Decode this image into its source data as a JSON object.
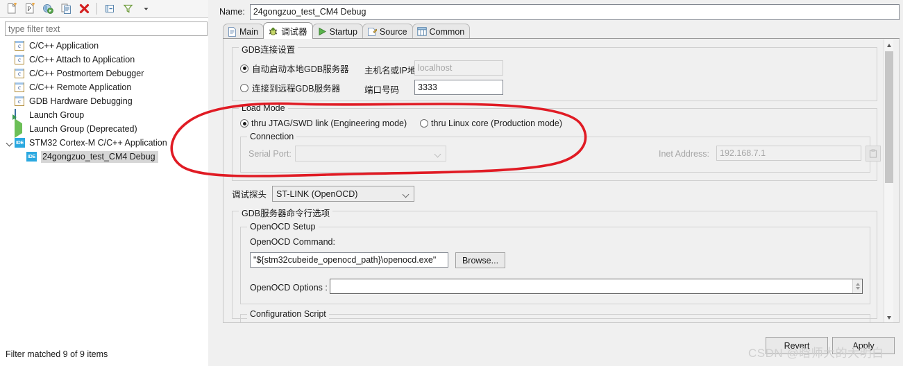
{
  "left_panel": {
    "toolbar": [
      {
        "name": "new-launch-configuration-icon",
        "title": "New launch configuration"
      },
      {
        "name": "new-prototype-icon",
        "title": "New prototype"
      },
      {
        "name": "new-launch-group-icon",
        "title": "New launch group"
      },
      {
        "name": "duplicate-icon",
        "title": "Duplicate"
      },
      {
        "name": "delete-icon",
        "title": "Delete"
      },
      {
        "name": "collapse-all-icon",
        "title": "Collapse All"
      },
      {
        "name": "filter-icon",
        "title": "Filter"
      },
      {
        "name": "view-menu-icon",
        "title": "View Menu"
      }
    ],
    "filter": {
      "value": "",
      "placeholder": "type filter text"
    },
    "tree": [
      {
        "label": "C/C++ Application",
        "icon": "c-file-icon",
        "indent": 1,
        "selected": false,
        "twisty": false
      },
      {
        "label": "C/C++ Attach to Application",
        "icon": "c-file-icon",
        "indent": 1,
        "selected": false,
        "twisty": false
      },
      {
        "label": "C/C++ Postmortem Debugger",
        "icon": "c-file-icon",
        "indent": 1,
        "selected": false,
        "twisty": false
      },
      {
        "label": "C/C++ Remote Application",
        "icon": "c-file-icon",
        "indent": 1,
        "selected": false,
        "twisty": false
      },
      {
        "label": "GDB Hardware Debugging",
        "icon": "c-file-icon",
        "indent": 1,
        "selected": false,
        "twisty": false
      },
      {
        "label": "Launch Group",
        "icon": "launch-group-icon",
        "indent": 1,
        "selected": false,
        "twisty": false
      },
      {
        "label": "Launch Group (Deprecated)",
        "icon": "play-icon",
        "indent": 1,
        "selected": false,
        "twisty": false
      },
      {
        "label": "STM32 Cortex-M C/C++ Application",
        "icon": "ide-icon",
        "indent": 0,
        "selected": false,
        "twisty": true
      },
      {
        "label": "24gongzuo_test_CM4 Debug",
        "icon": "ide-icon",
        "indent": 2,
        "selected": true,
        "twisty": false
      }
    ],
    "status": "Filter matched 9 of 9 items"
  },
  "right_panel": {
    "name_label": "Name:",
    "name_value": "24gongzuo_test_CM4 Debug",
    "tabs": [
      {
        "label": "Main",
        "icon": "document-icon",
        "active": false
      },
      {
        "label": "调试器",
        "icon": "bug-icon",
        "active": true
      },
      {
        "label": "Startup",
        "icon": "play-icon",
        "active": false
      },
      {
        "label": "Source",
        "icon": "source-icon",
        "active": false
      },
      {
        "label": "Common",
        "icon": "common-icon",
        "active": false
      }
    ],
    "gdb_connection": {
      "title": "GDB连接设置",
      "auto_start_label": "自动启动本地GDB服务器",
      "auto_start_selected": true,
      "remote_label": "连接到远程GDB服务器",
      "remote_selected": false,
      "host_label": "主机名或IP地址",
      "host_value": "localhost",
      "host_disabled": true,
      "port_label": "端口号码",
      "port_value": "3333"
    },
    "load_mode": {
      "title": "Load Mode",
      "jtag_label": "thru JTAG/SWD link (Engineering mode)",
      "jtag_selected": true,
      "linux_label": "thru Linux core (Production mode)",
      "linux_selected": false,
      "connection": {
        "title": "Connection",
        "serial_port_label": "Serial Port:",
        "serial_port_value": "",
        "serial_port_disabled": true,
        "inet_label": "Inet Address:",
        "inet_value": "192.168.7.1",
        "inet_disabled": true,
        "clipboard_icon": "clipboard-icon"
      }
    },
    "debug_probe": {
      "label": "调试探头",
      "value": "ST-LINK (OpenOCD)"
    },
    "gdb_server_options": {
      "title": "GDB服务器命令行选项",
      "openocd_setup": {
        "title": "OpenOCD Setup",
        "command_label": "OpenOCD Command:",
        "command_value": "\"${stm32cubeide_openocd_path}\\openocd.exe\"",
        "browse_label": "Browse...",
        "options_label": "OpenOCD Options :",
        "options_value": ""
      },
      "configuration_script": {
        "title": "Configuration Script"
      }
    },
    "buttons": {
      "revert": "Revert",
      "apply": "Apply"
    },
    "scrollbar": {
      "up_icon": "chevron-up-icon",
      "down_icon": "chevron-down-icon"
    }
  },
  "annotation": {
    "shape": "ellipse",
    "color": "#e01b24",
    "target": "Load Mode"
  },
  "watermark": "CSDN @晗师大的大明白",
  "colors": {
    "accent": "#2aa8e0",
    "annotation_red": "#e01b24",
    "panel_bg": "#f0f0f0",
    "selection": "#d6d6d6"
  }
}
